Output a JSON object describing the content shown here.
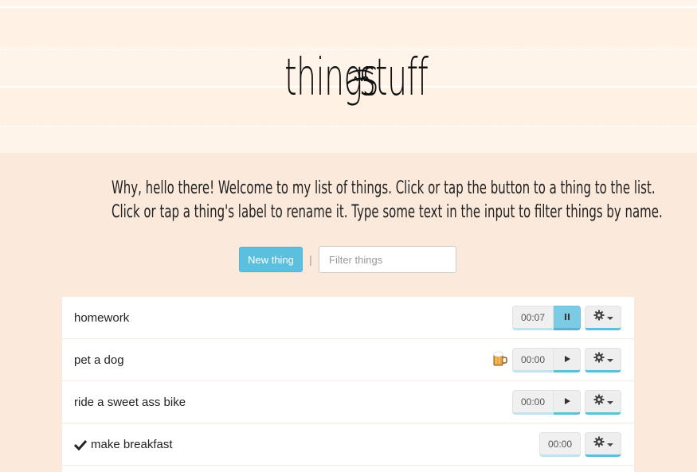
{
  "header": {
    "title_left": "things",
    "title_and": "AND",
    "title_right": "stuff"
  },
  "intro": {
    "line1": "Why, hello there! Welcome to my list of things. Click or tap the button to a thing to the list.",
    "line2": "Click or tap a thing's label to rename it. Type some text in the input to filter things by name."
  },
  "controls": {
    "new_label": "New thing",
    "separator": "|",
    "filter_placeholder": "Filter things"
  },
  "things": [
    {
      "label": "homework",
      "time": "00:07",
      "state": "running",
      "done": false,
      "emoji": null
    },
    {
      "label": "pet a dog",
      "time": "00:00",
      "state": "paused",
      "done": false,
      "emoji": "beer-mug"
    },
    {
      "label": "ride a sweet ass bike",
      "time": "00:00",
      "state": "paused",
      "done": false,
      "emoji": null
    },
    {
      "label": "make breakfast",
      "time": "00:00",
      "state": "done",
      "done": true,
      "emoji": null
    }
  ],
  "colors": {
    "accent": "#5bc0de",
    "header_bg": "#fff4ea",
    "page_bg": "#fbe9db"
  }
}
